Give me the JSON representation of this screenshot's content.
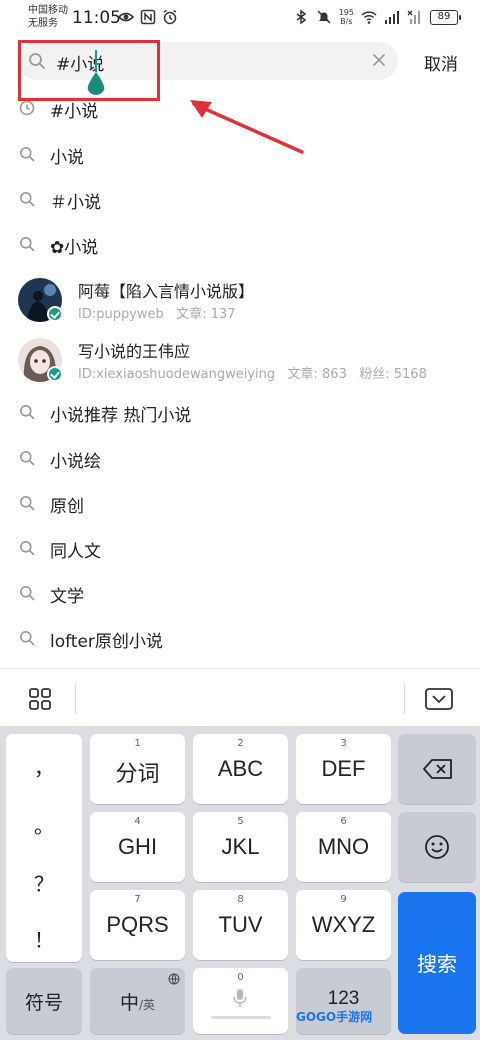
{
  "status_bar": {
    "carrier": "中国移动",
    "carrier_sub": "无服务",
    "time": "11:05",
    "net_speed_value": "195",
    "net_speed_unit": "B/s",
    "battery": "89"
  },
  "search": {
    "query": "#小说",
    "cancel_label": "取消"
  },
  "suggestions_top": [
    {
      "label": "#小说",
      "icon": "history-clock-icon"
    },
    {
      "label": "小说",
      "icon": "search-icon"
    },
    {
      "label": "＃小说",
      "icon": "search-icon"
    },
    {
      "label": "✿小说",
      "icon": "search-icon"
    }
  ],
  "users": [
    {
      "name": "阿莓【陷入言情小说版】",
      "id": "ID:puppyweb",
      "articles": "文章: 137",
      "fans": ""
    },
    {
      "name": "写小说的王伟应",
      "id": "ID:xiexiaoshuodewangweiying",
      "articles": "文章: 863",
      "fans": "粉丝: 5168"
    }
  ],
  "suggestions_bottom": [
    {
      "label": "小说推荐 热门小说"
    },
    {
      "label": "小说绘"
    },
    {
      "label": "原创"
    },
    {
      "label": "同人文"
    },
    {
      "label": "文学"
    },
    {
      "label": "lofter原创小说"
    }
  ],
  "keyboard": {
    "symbols": [
      "，",
      "。",
      "？",
      "！"
    ],
    "keys": [
      {
        "num": "1",
        "label": "分词"
      },
      {
        "num": "2",
        "label": "ABC"
      },
      {
        "num": "3",
        "label": "DEF"
      },
      {
        "num": "4",
        "label": "GHI"
      },
      {
        "num": "5",
        "label": "JKL"
      },
      {
        "num": "6",
        "label": "MNO"
      },
      {
        "num": "7",
        "label": "PQRS"
      },
      {
        "num": "8",
        "label": "TUV"
      },
      {
        "num": "9",
        "label": "WXYZ"
      }
    ],
    "symbol_key": "符号",
    "lang_key_main": "中",
    "lang_key_sub": "/英",
    "space_num": "0",
    "num_key": "123",
    "search_key": "搜索"
  },
  "watermark": "GOGO手游网",
  "colors": {
    "accent": "#1a9b8a",
    "highlight": "#e03038",
    "search_key": "#1a74ee"
  }
}
